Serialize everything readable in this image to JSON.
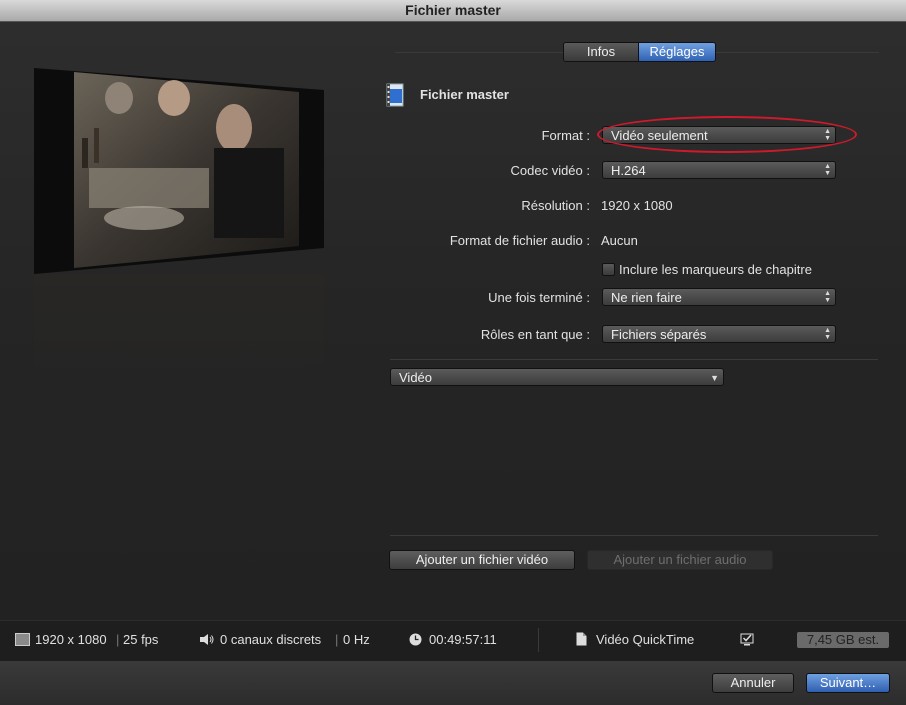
{
  "window": {
    "title": "Fichier master"
  },
  "tabs": [
    {
      "label": "Infos",
      "selected": false
    },
    {
      "label": "Réglages",
      "selected": true
    }
  ],
  "section": {
    "title": "Fichier master",
    "icon": "film-file-icon"
  },
  "settings": {
    "format": {
      "label": "Format :",
      "value": "Vidéo seulement"
    },
    "codec": {
      "label": "Codec vidéo :",
      "value": "H.264"
    },
    "resolution": {
      "label": "Résolution :",
      "value": "1920 x 1080"
    },
    "audio_format": {
      "label": "Format de fichier audio :",
      "value": "Aucun"
    },
    "chapters_checkbox": {
      "label": "Inclure les marqueurs de chapitre",
      "checked": false
    },
    "when_done": {
      "label": "Une fois terminé :",
      "value": "Ne rien faire"
    },
    "roles": {
      "label": "Rôles en tant que :",
      "value": "Fichiers séparés"
    }
  },
  "video_popup": {
    "value": "Vidéo"
  },
  "buttons": {
    "add_video": "Ajouter un fichier vidéo",
    "add_audio": "Ajouter un fichier audio",
    "cancel": "Annuler",
    "next": "Suivant…"
  },
  "status": {
    "resolution": "1920 x 1080",
    "fps": "25 fps",
    "audio_channels": "0 canaux discrets",
    "sample_rate": "0 Hz",
    "duration": "00:49:57:11",
    "file_type": "Vidéo QuickTime",
    "size_estimate": "7,45 GB est."
  },
  "colors": {
    "accent": "#3a6fc4",
    "highlight_circle": "#d01a2c"
  }
}
